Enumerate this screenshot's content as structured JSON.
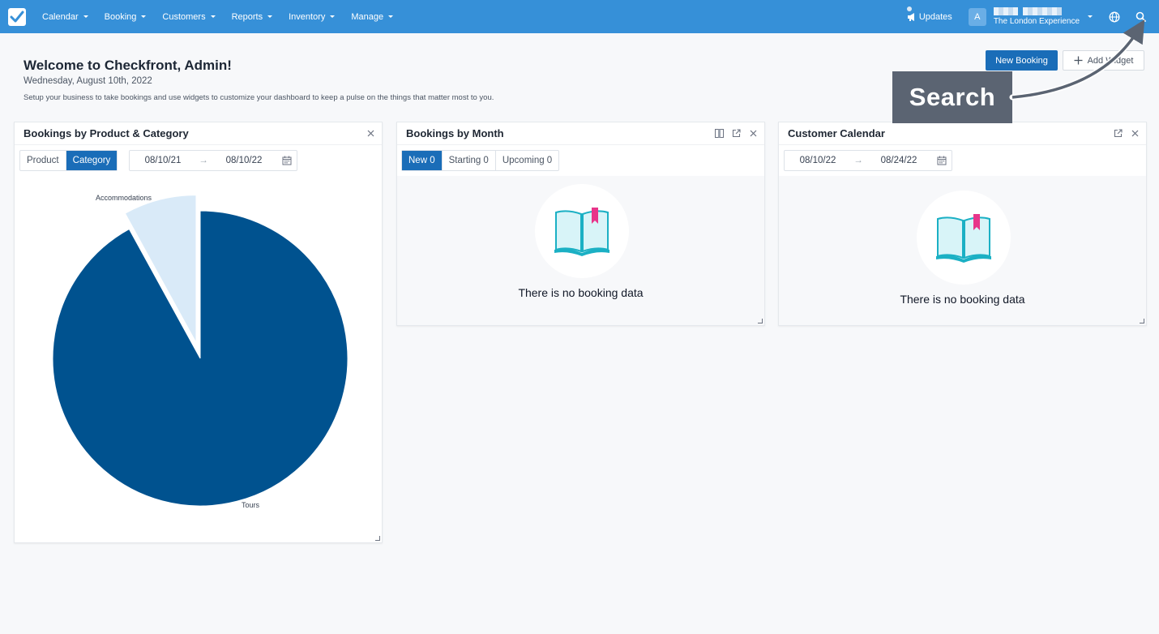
{
  "nav": {
    "items": [
      {
        "label": "Calendar"
      },
      {
        "label": "Booking"
      },
      {
        "label": "Customers"
      },
      {
        "label": "Reports"
      },
      {
        "label": "Inventory"
      },
      {
        "label": "Manage"
      }
    ],
    "updates_label": "Updates",
    "avatar_letter": "A",
    "account_name": "The London Experience"
  },
  "header": {
    "title": "Welcome to Checkfront, Admin!",
    "date": "Wednesday, August 10th, 2022",
    "subtitle": "Setup your business to take bookings and use widgets to customize your dashboard to keep a pulse on the things that matter most to you.",
    "new_booking_label": "New Booking",
    "add_widget_label": "Add Widget"
  },
  "callout": {
    "label": "Search"
  },
  "widgets": {
    "product_category": {
      "title": "Bookings by Product & Category",
      "tabs": [
        {
          "label": "Product",
          "active": false
        },
        {
          "label": "Category",
          "active": true
        }
      ],
      "date_from": "08/10/21",
      "date_to": "08/10/22"
    },
    "by_month": {
      "title": "Bookings by Month",
      "tabs": [
        {
          "label": "New 0",
          "active": true
        },
        {
          "label": "Starting 0",
          "active": false
        },
        {
          "label": "Upcoming 0",
          "active": false
        }
      ],
      "empty_text": "There is no booking data"
    },
    "customer_calendar": {
      "title": "Customer Calendar",
      "date_from": "08/10/22",
      "date_to": "08/24/22",
      "empty_text": "There is no booking data"
    }
  },
  "colors": {
    "nav": "#3690d8",
    "primary": "#1a6db8",
    "pie_main": "#00528f",
    "pie_secondary": "#d9eaf8",
    "callout": "#5b6472"
  },
  "chart_data": {
    "type": "pie",
    "categories": [
      "Tours",
      "Accommodations"
    ],
    "values": [
      92,
      8
    ],
    "exploded": "Accommodations"
  }
}
